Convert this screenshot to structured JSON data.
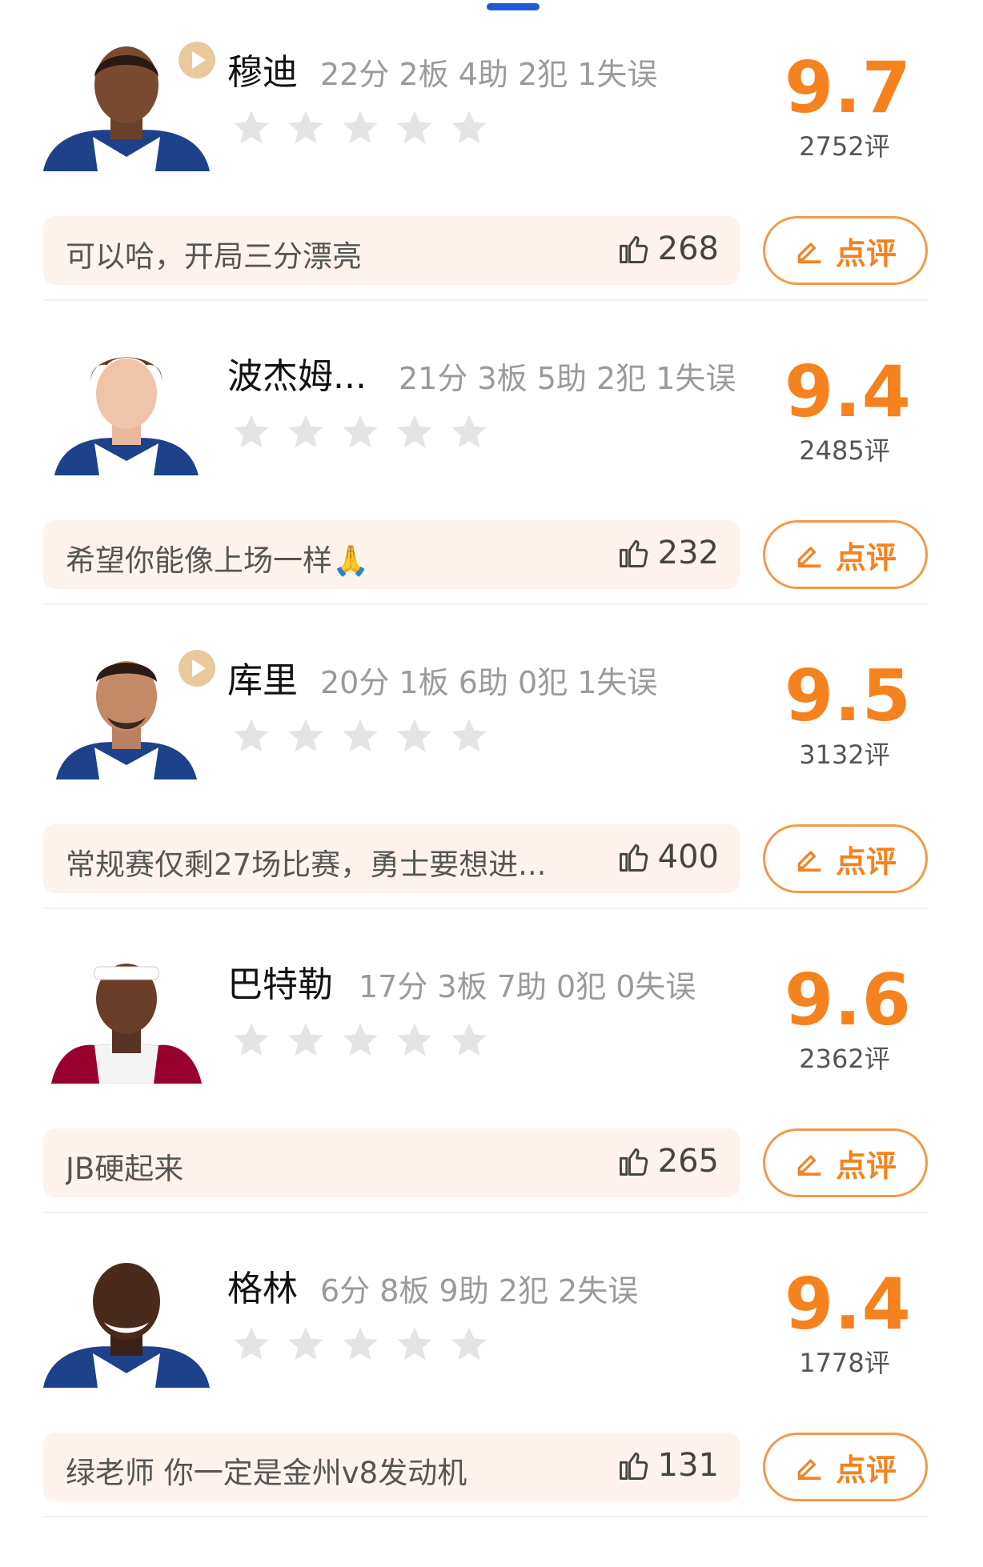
{
  "players": [
    {
      "name": "穆迪",
      "stats": "22分 2板 4助 2犯 1失误",
      "score": "9.7",
      "rating_count": "2752评",
      "comment": "可以哈，开局三分漂亮",
      "likes": "268",
      "review_label": "点评",
      "has_play": true,
      "stars_filled": 0
    },
    {
      "name": "波杰姆...",
      "stats": "21分 3板 5助 2犯 1失误",
      "score": "9.4",
      "rating_count": "2485评",
      "comment": "希望你能像上场一样🙏",
      "likes": "232",
      "review_label": "点评",
      "has_play": false,
      "stars_filled": 0
    },
    {
      "name": "库里",
      "stats": "20分 1板 6助 0犯 1失误",
      "score": "9.5",
      "rating_count": "3132评",
      "comment": "常规赛仅剩27场比赛，勇士要想进...",
      "likes": "400",
      "review_label": "点评",
      "has_play": true,
      "stars_filled": 0
    },
    {
      "name": "巴特勒",
      "stats": "17分 3板 7助 0犯 0失误",
      "score": "9.6",
      "rating_count": "2362评",
      "comment": "JB硬起来",
      "likes": "265",
      "review_label": "点评",
      "has_play": false,
      "stars_filled": 0
    },
    {
      "name": "格林",
      "stats": "6分 8板 9助 2犯 2失误",
      "score": "9.4",
      "rating_count": "1778评",
      "comment": "绿老师 你一定是金州v8发动机",
      "likes": "131",
      "review_label": "点评",
      "has_play": false,
      "stars_filled": 0
    }
  ],
  "icons": {
    "play": "play-icon",
    "star": "star-icon",
    "like": "thumbs-up-icon",
    "edit": "edit-pen-icon"
  },
  "colors": {
    "accent": "#f5821f",
    "score": "#f5821f",
    "comment_bg": "#fdf3ec",
    "star_empty": "#e4e4e4",
    "indicator": "#1f57d6"
  }
}
